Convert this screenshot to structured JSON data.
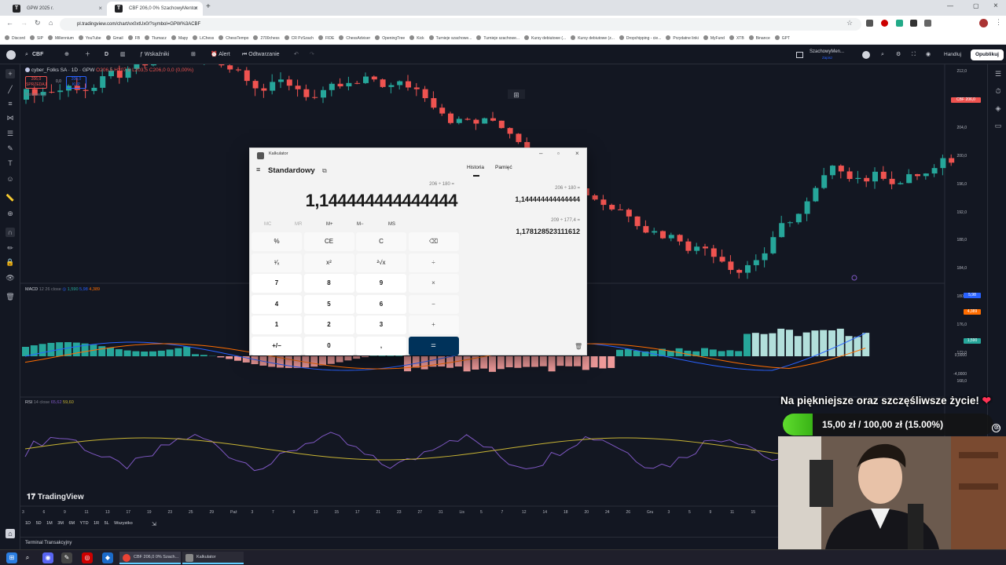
{
  "browser": {
    "tabs": [
      {
        "title": "GPW 2025 r.",
        "fav": "T"
      },
      {
        "title": "CBF 206,0 0% SzachowyMentor",
        "fav": "T"
      }
    ],
    "url": "pl.tradingview.com/chart/vx0xtUx0/?symbol=GPW%3ACBF",
    "bookmarks": [
      "Discord",
      "SIP",
      "Millennium",
      "YouTube",
      "Gmail",
      "FB",
      "Tłumacz",
      "Mapy",
      "LiChess",
      "ChessTempo",
      "2700chess",
      "CR PzSzach",
      "FIDE",
      "ChessAdviser",
      "OpeningTree",
      "Kick",
      "Turnieje szachowe...",
      "Turnieje szachowe...",
      "Kursy debiutowe (...",
      "Kursy debiutowe (z...",
      "Dropchipping - cie...",
      "Przydatne linki",
      "MyFund",
      "XTB",
      "Binance",
      "GPT"
    ]
  },
  "tv_toolbar": {
    "symbol": "CBF",
    "interval": "D",
    "indicators": "Wskaźniki",
    "alert": "Alert",
    "replay": "Odtwarzanie",
    "layout_name": "SzachowyMen...",
    "layout_sub": "Zapisz",
    "trade": "Handluj",
    "publish": "Opublikuj"
  },
  "legend": {
    "name": "cyber_Folks SA · 1D · GPW",
    "ohlc": "O206,5 H207,0 L203,5 C206,0 0,0 (0,00%)",
    "sell": "206,0",
    "sell_lbl": "SPRZEDAJ",
    "spread": "0,0",
    "buy": "206,0",
    "buy_lbl": "KUP",
    "volume": "Wolumen"
  },
  "price_axis": [
    "212,0",
    "208,0",
    "204,0",
    "200,0",
    "196,0",
    "192,0",
    "188,0",
    "184,0",
    "180,0",
    "176,0",
    "172,0",
    "168,0"
  ],
  "price_tag": {
    "symbol": "CBF",
    "value": "206,0"
  },
  "macd": {
    "label": "MACD",
    "params": "12 26 close",
    "v1": "1,590",
    "v2": "5,98",
    "v3": "4,389",
    "axis_tags": [
      "5,98",
      "4,389",
      "1,590"
    ],
    "zero": "0,0000",
    "neg": "-4,0000"
  },
  "rsi": {
    "label": "RSI",
    "params": "14 close",
    "v1": "65,62",
    "v2": "59,60"
  },
  "time_axis": [
    "3",
    "6",
    "9",
    "11",
    "13",
    "17",
    "19",
    "23",
    "25",
    "29",
    "Paź",
    "3",
    "7",
    "9",
    "13",
    "15",
    "17",
    "21",
    "23",
    "27",
    "31",
    "Lis",
    "5",
    "7",
    "12",
    "14",
    "18",
    "20",
    "24",
    "26",
    "Gru",
    "3",
    "5",
    "9",
    "11",
    "15"
  ],
  "tradingview_logo": "TradingView",
  "ranges": [
    "1D",
    "5D",
    "1M",
    "3M",
    "6M",
    "YTD",
    "1R",
    "5L",
    "Wszystko"
  ],
  "terminal": "Terminal Transakcyjny",
  "calculator": {
    "title": "Kalkulator",
    "mode": "Standardowy",
    "expression": "206 ÷ 180 =",
    "display": "1,144444444444444",
    "tabs": [
      "Historia",
      "Pamięć"
    ],
    "memory": [
      "MC",
      "MR",
      "M+",
      "M−",
      "MS"
    ],
    "keys": [
      [
        "%",
        "CE",
        "C",
        "⌫"
      ],
      [
        "¹⁄ₓ",
        "x²",
        "²√x",
        "÷"
      ],
      [
        "7",
        "8",
        "9",
        "×"
      ],
      [
        "4",
        "5",
        "6",
        "−"
      ],
      [
        "1",
        "2",
        "3",
        "+"
      ],
      [
        "+/−",
        "0",
        ",",
        "="
      ]
    ],
    "history": [
      {
        "expr": "206 ÷ 180 =",
        "result": "1,144444444444444"
      },
      {
        "expr": "209 ÷ 177,4 =",
        "result": "1,178128523111612"
      }
    ]
  },
  "overlay": {
    "goal_text": "Na piękniejsze oraz szczęśliwsze życie!",
    "amount": "15,00 zł / 100,00 zł (15.00%)",
    "progress": 0.15
  },
  "taskbar": {
    "items": [
      "CBF 206,0 0% Szach...",
      "Kalkulator"
    ]
  },
  "colors": {
    "up": "#26a69a",
    "down": "#ef5350",
    "bg": "#131722",
    "eq_button": "#00325a",
    "progress": "#4cc623"
  }
}
